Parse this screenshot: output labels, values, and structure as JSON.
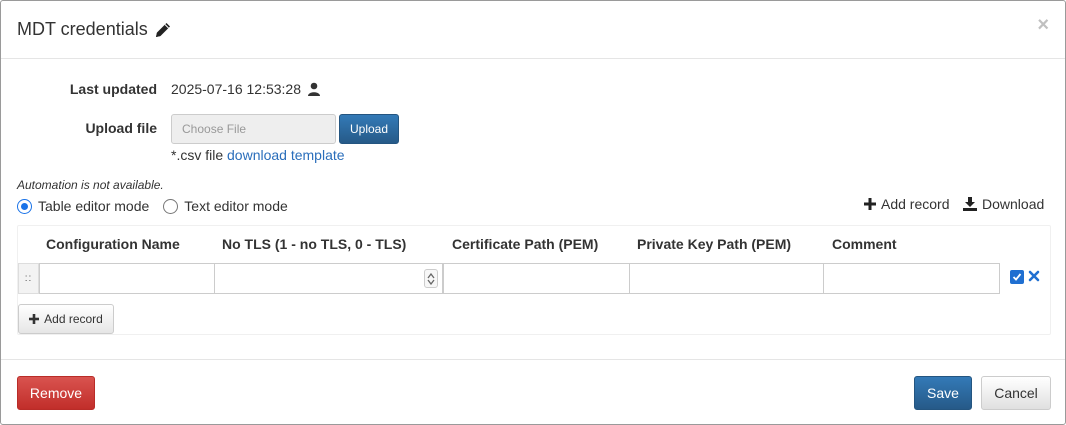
{
  "modal": {
    "title": "MDT credentials",
    "close_label": "×"
  },
  "form": {
    "last_updated_label": "Last updated",
    "last_updated_value": "2025-07-16 12:53:28",
    "upload_label": "Upload file",
    "file_placeholder": "Choose File",
    "upload_button": "Upload",
    "csv_hint_prefix": "*.csv file",
    "download_template_link": "download template"
  },
  "editor": {
    "automation_note": "Automation is not available.",
    "mode_options": [
      {
        "label": "Table editor mode",
        "selected": true
      },
      {
        "label": "Text editor mode",
        "selected": false
      }
    ],
    "add_record_action": "Add record",
    "download_action": "Download"
  },
  "table": {
    "columns": [
      "Configuration Name",
      "No TLS (1 - no TLS, 0 - TLS)",
      "Certificate Path (PEM)",
      "Private Key Path (PEM)",
      "Comment"
    ],
    "rows": [
      {
        "configuration_name": "",
        "no_tls": "",
        "certificate_path": "",
        "private_key_path": "",
        "comment": "",
        "enabled": true
      }
    ],
    "row_handle": "::",
    "add_record_button": "Add record"
  },
  "footer": {
    "remove_button": "Remove",
    "save_button": "Save",
    "cancel_button": "Cancel"
  },
  "colors": {
    "primary": "#2e6da4",
    "danger": "#d9534f",
    "link": "#2a6ebb",
    "check": "#1f6fd1"
  }
}
